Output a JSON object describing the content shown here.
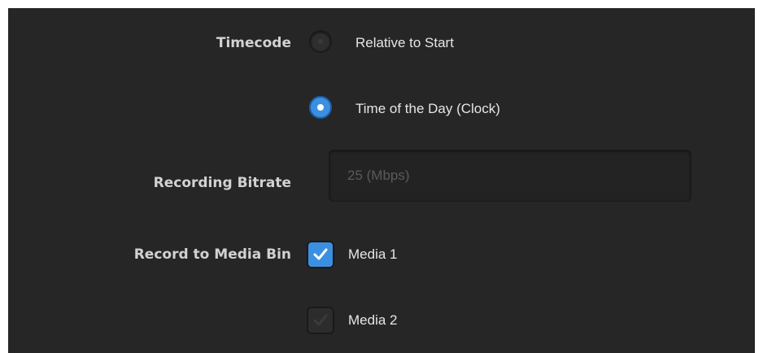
{
  "timecode": {
    "label": "Timecode",
    "options": [
      {
        "label": "Relative to Start",
        "selected": false
      },
      {
        "label": "Time of the Day (Clock)",
        "selected": true
      }
    ]
  },
  "bitrate": {
    "label": "Recording Bitrate",
    "placeholder": "25 (Mbps)"
  },
  "media_bin": {
    "label": "Record to Media Bin",
    "items": [
      {
        "label": "Media 1",
        "checked": true
      },
      {
        "label": "Media 2",
        "checked": false
      }
    ]
  },
  "colors": {
    "panel_bg": "#262626",
    "accent": "#3b8fe0",
    "label_text": "#d2d2d2",
    "option_text": "#e6e6e6",
    "placeholder_text": "#5a5a5a"
  },
  "icons": {
    "checkmark": "checkmark-icon"
  }
}
